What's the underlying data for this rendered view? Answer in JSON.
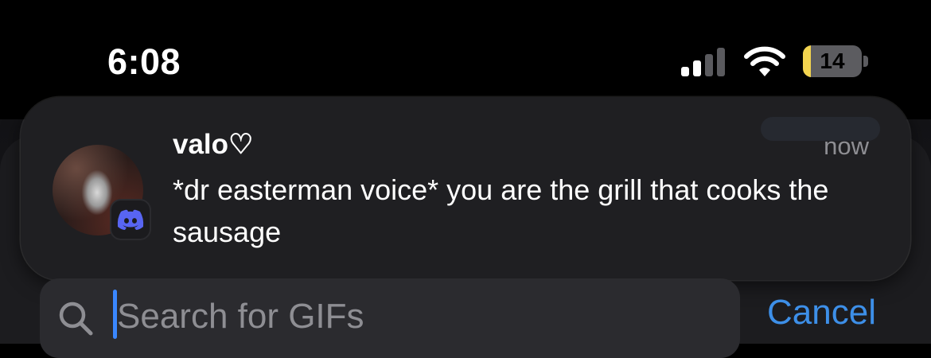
{
  "status_bar": {
    "time": "6:08",
    "battery_percent": "14",
    "battery_level": 0.14,
    "signal_bars_active": 2,
    "signal_bars_total": 4,
    "icons": [
      "cellular-signal-icon",
      "wifi-icon",
      "battery-icon"
    ]
  },
  "notification": {
    "sender": "valo♡",
    "time": "now",
    "message": "*dr easterman voice* you are the grill that cooks the sausage",
    "app_icon": "discord-icon"
  },
  "search": {
    "placeholder": "Search for GIFs",
    "value": "",
    "cancel_label": "Cancel"
  },
  "colors": {
    "accent": "#3d8fe8",
    "battery_low": "#f3d44f",
    "discord": "#5865f2"
  }
}
